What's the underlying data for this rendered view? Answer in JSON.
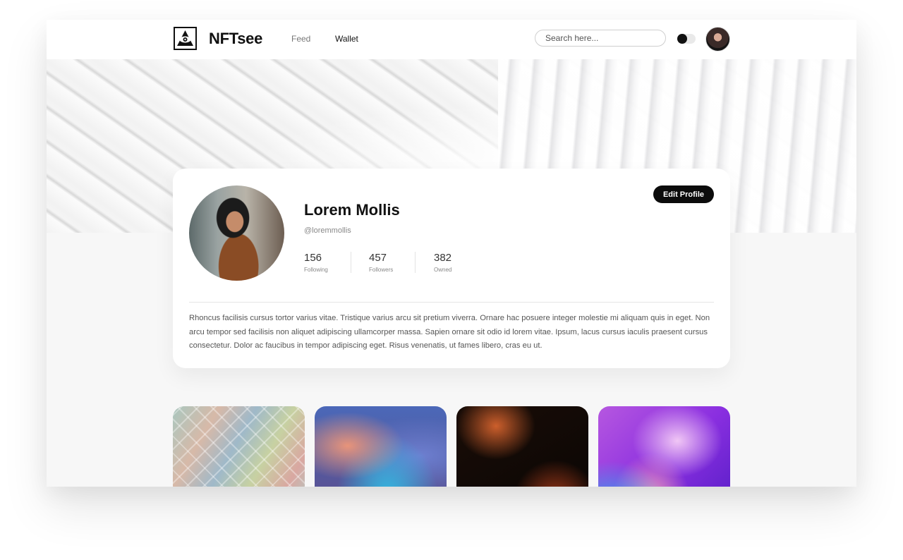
{
  "nav": {
    "brand": "NFTsee",
    "links": [
      {
        "label": "Feed",
        "active": false
      },
      {
        "label": "Wallet",
        "active": true
      }
    ],
    "search_placeholder": "Search here...",
    "theme_toggle": "dark"
  },
  "profile": {
    "name": "Lorem Mollis",
    "handle": "@loremmollis",
    "stats": [
      {
        "value": "156",
        "label": "Following"
      },
      {
        "value": "457",
        "label": "Followers"
      },
      {
        "value": "382",
        "label": "Owned"
      }
    ],
    "edit_label": "Edit Profile",
    "bio": "Rhoncus facilisis cursus tortor varius vitae. Tristique varius arcu sit pretium viverra. Ornare hac posuere integer molestie mi aliquam quis in eget. Non arcu tempor sed facilisis non aliquet adipiscing ullamcorper massa. Sapien ornare sit odio id lorem vitae. Ipsum, lacus cursus iaculis praesent cursus consectetur. Dolor ac faucibus in tempor adipiscing eget. Risus venenatis, ut fames libero, cras eu ut."
  },
  "colors": {
    "accent": "#0c0c0c",
    "page_background": "#f7f7f7",
    "card_background": "#ffffff"
  }
}
